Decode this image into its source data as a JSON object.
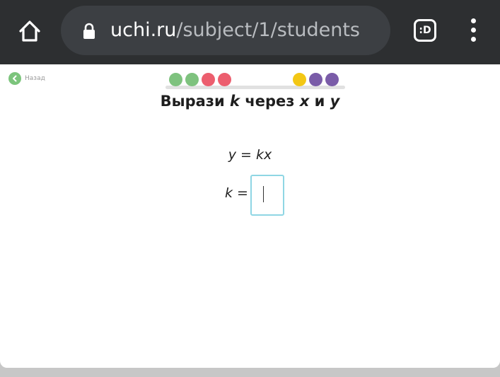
{
  "browser": {
    "home_icon": "home-icon",
    "lock_icon": "lock-icon",
    "url_domain": "uchi.ru",
    "url_path": "/subject/1/students",
    "tab_button_label": ":D",
    "menu_icon": "kebab-menu-icon"
  },
  "page": {
    "back_label": "Назад",
    "progress": [
      {
        "status": "correct",
        "color": "#7ec27e"
      },
      {
        "status": "correct",
        "color": "#7ec27e"
      },
      {
        "status": "wrong",
        "color": "#ec5e6e"
      },
      {
        "status": "wrong",
        "color": "#ec5e6e"
      },
      {
        "status": "pending",
        "color": "#f3c714"
      },
      {
        "status": "pending",
        "color": "#7a5ca8"
      },
      {
        "status": "pending",
        "color": "#7a5ca8"
      }
    ],
    "title_prefix": "Вырази ",
    "title_var_k": "k",
    "title_middle": " через ",
    "title_var_x": "x",
    "title_and": " и ",
    "title_var_y": "y",
    "equation": "y = kx",
    "answer_label": "k =",
    "answer_value": ""
  }
}
